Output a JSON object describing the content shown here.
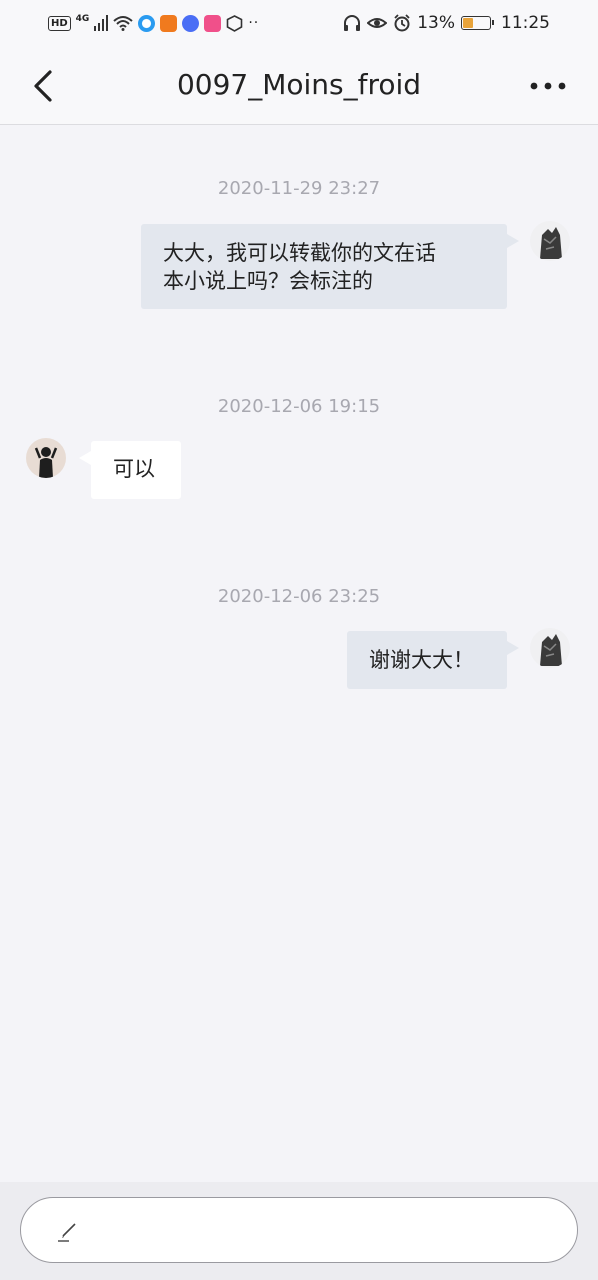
{
  "status_bar": {
    "hd": "HD",
    "network": "4G",
    "battery_percent": "13%",
    "battery_level": 0.13,
    "time": "11:25",
    "icons": [
      "hd-icon",
      "signal-icon",
      "wifi-icon",
      "app-icon-blue",
      "app-icon-orange",
      "app-icon-music",
      "app-icon-pink",
      "app-icon-shield",
      "more-dots-icon",
      "headset-icon",
      "eye-icon",
      "alarm-icon",
      "battery-icon"
    ],
    "dots": "··"
  },
  "nav": {
    "title": "0097_Moins_froid",
    "back_icon": "chevron-left-icon",
    "more_icon": "more-horizontal-icon"
  },
  "messages": [
    {
      "timestamp": "2020-11-29 23:27",
      "side": "right",
      "text_lines": [
        "大大，我可以转截你的文在话",
        "本小说上吗？会标注的"
      ]
    },
    {
      "timestamp": "2020-12-06 19:15",
      "side": "left",
      "text_lines": [
        "可以"
      ]
    },
    {
      "timestamp": "2020-12-06 23:25",
      "side": "right",
      "text_lines": [
        "谢谢大大！"
      ]
    }
  ],
  "input": {
    "placeholder": "",
    "icon": "pen-icon"
  },
  "colors": {
    "background": "#f4f4f8",
    "outgoing_bubble": "#e3e7ee",
    "incoming_bubble": "#ffffff",
    "timestamp": "#a8a8b0",
    "battery_fill": "#e8a33a"
  }
}
